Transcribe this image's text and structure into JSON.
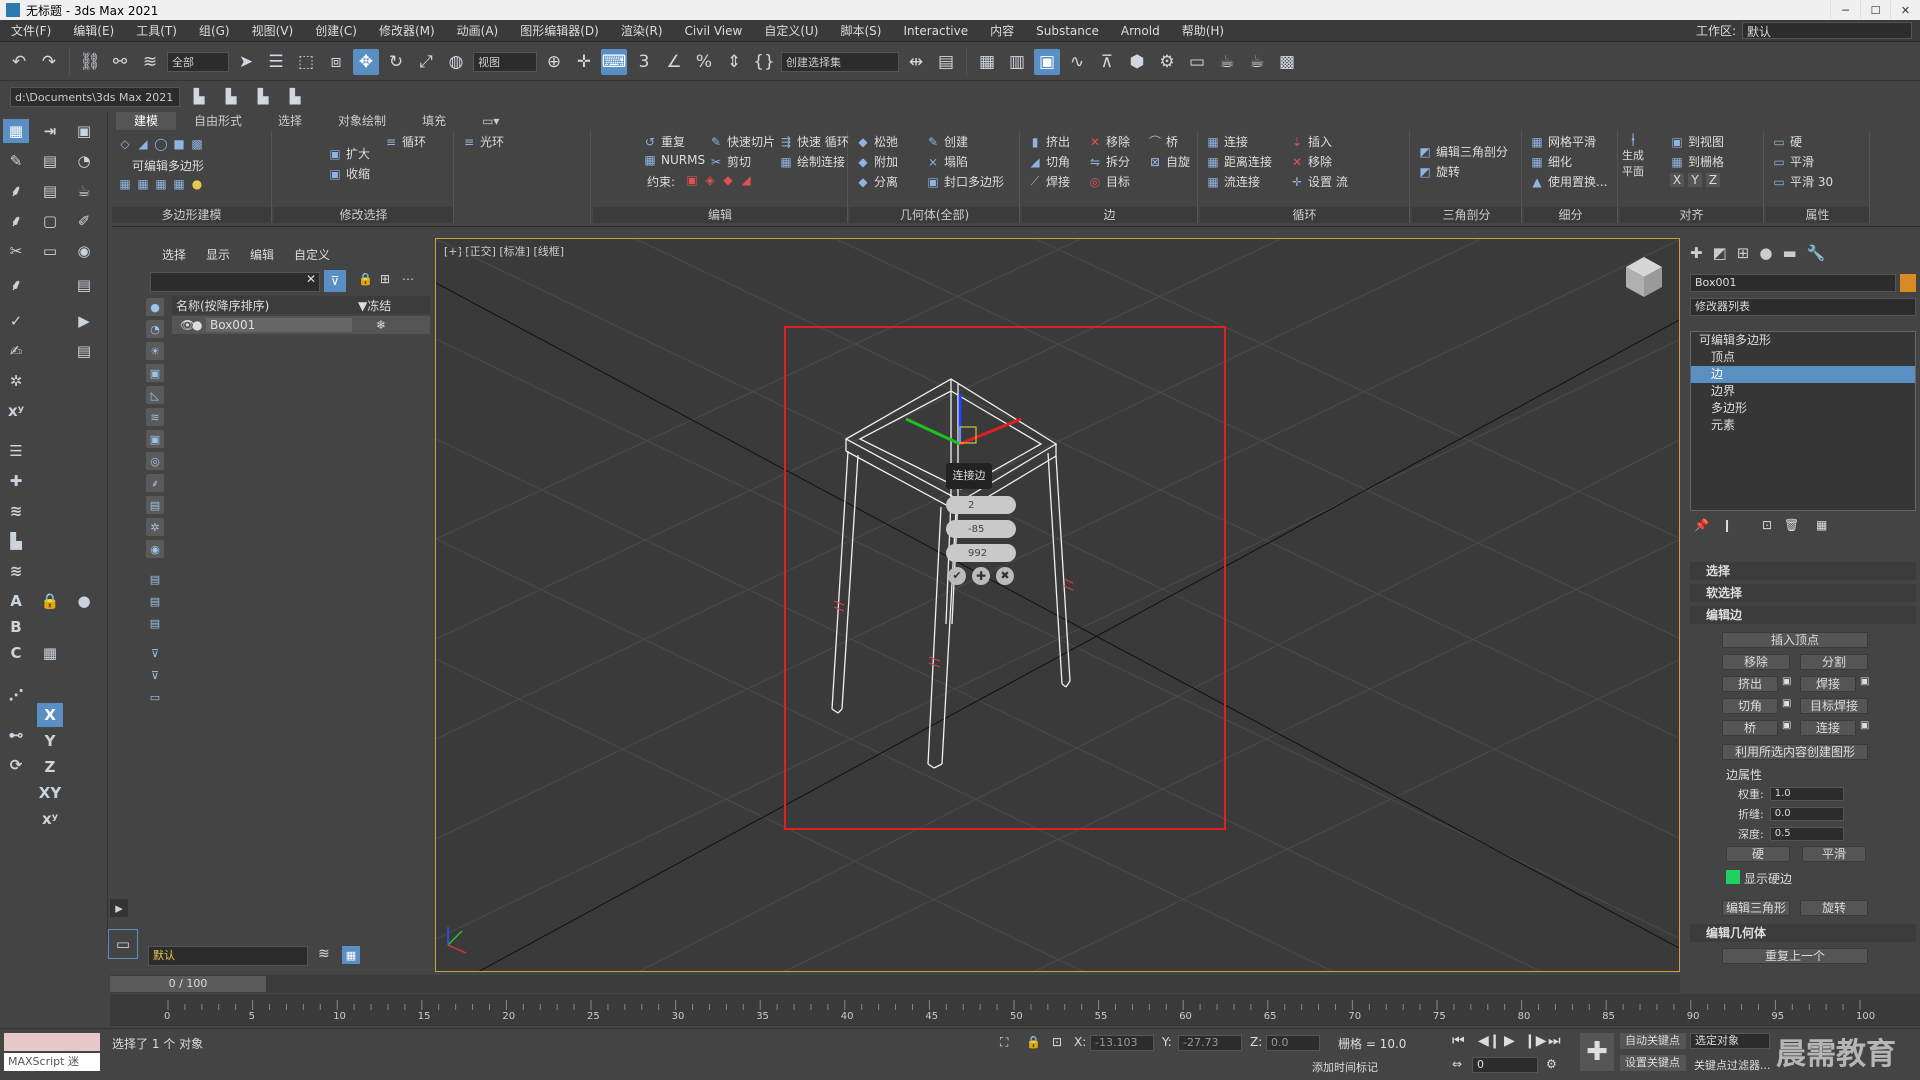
{
  "window": {
    "title": "无标题 - 3ds Max 2021"
  },
  "menu": [
    "文件(F)",
    "编辑(E)",
    "工具(T)",
    "组(G)",
    "视图(V)",
    "创建(C)",
    "修改器(M)",
    "动画(A)",
    "图形编辑器(D)",
    "渲染(R)",
    "Civil View",
    "自定义(U)",
    "脚本(S)",
    "Interactive",
    "内容",
    "Substance",
    "Arnold",
    "帮助(H)"
  ],
  "workspace": {
    "label": "工作区:",
    "value": "默认"
  },
  "toolbar": {
    "filter": "全部",
    "ref_coord": "视图",
    "selection_set": "创建选择集"
  },
  "project_path": "d:\\Documents\\3ds Max 2021",
  "ribbon": {
    "tabs": [
      "建模",
      "自由形式",
      "选择",
      "对象绘制",
      "填充"
    ],
    "groups": {
      "polygon_modeling": "多边形建模",
      "modify_selection": "修改选择",
      "edit": "编辑",
      "geometry": "几何体(全部)",
      "edges": "边",
      "loops": "循环",
      "tris": "三角剖分",
      "subdivision": "细分",
      "align": "对齐",
      "properties": "属性"
    },
    "editable_poly": "可编辑多边形",
    "buttons": {
      "grow": "扩大",
      "shrink": "收缩",
      "loop": "循环",
      "ring": "光环",
      "repeat": "重复",
      "quickslice": "快速切片",
      "quickloop": "快速 循环",
      "nurms": "NURMS",
      "cut": "剪切",
      "paintconnect": "绘制连接",
      "constraint": "约束:",
      "relax": "松弛",
      "create": "创建",
      "attach": "附加",
      "collapse": "塌陷",
      "detach": "分离",
      "cap": "封口多边形",
      "extrude": "挤出",
      "remove": "移除",
      "bridge": "桥",
      "chamfer": "切角",
      "split": "拆分",
      "spin": "自旋",
      "weld": "焊接",
      "target": "目标",
      "connect": "连接",
      "insert": "插入",
      "distconnect": "距离连接",
      "loopremove": "移除",
      "flow": "流连接",
      "setflow": "设置 流",
      "edittri": "编辑三角剖分",
      "turn": "旋转",
      "meshsmooth": "网格平滑",
      "tessellate": "细化",
      "usedisp": "使用置换...",
      "generate": "生成",
      "plane": "平面",
      "toview": "到视图",
      "togrid": "到栅格",
      "hard": "硬",
      "smooth": "平滑",
      "smooth30": "平滑 30"
    }
  },
  "explorer": {
    "tabs": [
      "选择",
      "显示",
      "编辑",
      "自定义"
    ],
    "col_name": "名称(按降序排序)",
    "col_frozen": "▼冻结",
    "rows": [
      {
        "name": "Box001"
      }
    ]
  },
  "viewport": {
    "label": "[+] [正交] [标准] [线框]",
    "caddy": {
      "title": "连接边",
      "segments": "2",
      "pinch": "-85",
      "slide": "992"
    }
  },
  "command_panel": {
    "object_name": "Box001",
    "modifier_list": "修改器列表",
    "stack": [
      "可编辑多边形",
      "顶点",
      "边",
      "边界",
      "多边形",
      "元素"
    ],
    "stack_selected": 2,
    "rollouts": {
      "select": "选择",
      "soft": "软选择",
      "edit_edges": "编辑边",
      "edit_geom": "编辑几何体"
    },
    "edit_edges": {
      "insert_vertex": "插入顶点",
      "remove": "移除",
      "split": "分割",
      "extrude": "挤出",
      "weld": "焊接",
      "chamfer": "切角",
      "target_weld": "目标焊接",
      "bridge": "桥",
      "connect": "连接",
      "create_shape": "利用所选内容创建图形",
      "edge_props": "边属性",
      "weight_label": "权重:",
      "weight": "1.0",
      "crease_label": "折缝:",
      "crease": "0.0",
      "depth_label": "深度:",
      "depth": "0.5",
      "hard": "硬",
      "smooth": "平滑",
      "display_hard": "显示硬边",
      "edit_tri": "编辑三角形",
      "turn": "旋转"
    },
    "repeat_last": "重复上一个"
  },
  "timeline": {
    "frame": "0 / 100",
    "ticks": [
      "0",
      "5",
      "10",
      "15",
      "20",
      "25",
      "30",
      "35",
      "40",
      "45",
      "50",
      "55",
      "60",
      "65",
      "70",
      "75",
      "80",
      "85",
      "90",
      "95",
      "100"
    ]
  },
  "status": {
    "maxscript": "MAXScript 迷",
    "message": "选择了 1 个 对象",
    "x_label": "X:",
    "x": "-13.103",
    "y_label": "Y:",
    "y": "-27.73",
    "z_label": "Z:",
    "z": "0.0",
    "grid": "栅格 = 10.0",
    "add_time_tag": "添加时间标记",
    "auto_key": "自动关键点",
    "set_key": "设置关键点",
    "selected": "选定对象",
    "key_filter": "关键点过滤器...",
    "frame_field": "0",
    "layer": "默认",
    "watermark": "晨需教育"
  }
}
